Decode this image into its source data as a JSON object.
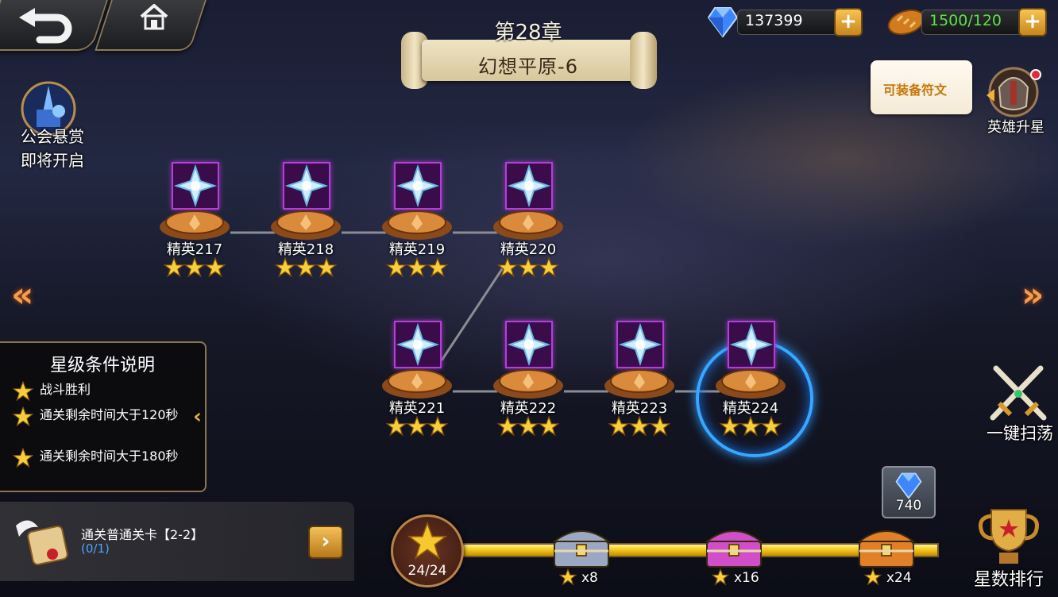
{
  "header": {
    "chapter": "第28章",
    "stage_name": "幻想平原-6"
  },
  "resources": {
    "diamonds": "137399",
    "stamina": "1500/120"
  },
  "left_panel": {
    "guild_bounty_line1": "公会悬赏",
    "guild_bounty_line2": "即将开启"
  },
  "tooltip": {
    "text": "可装备符文"
  },
  "right_panel": {
    "hero_star_up": "英雄升星",
    "one_click_sweep": "一键扫荡",
    "star_ranking": "星数排行"
  },
  "stages": [
    {
      "label": "精英217",
      "stars": 3
    },
    {
      "label": "精英218",
      "stars": 3
    },
    {
      "label": "精英219",
      "stars": 3
    },
    {
      "label": "精英220",
      "stars": 3
    },
    {
      "label": "精英221",
      "stars": 3
    },
    {
      "label": "精英222",
      "stars": 3
    },
    {
      "label": "精英223",
      "stars": 3
    },
    {
      "label": "精英224",
      "stars": 3,
      "selected": true
    }
  ],
  "star_conditions": {
    "title": "星级条件说明",
    "items": [
      "战斗胜利",
      "通关剩余时间大于120秒",
      "通关剩余时间大于180秒"
    ]
  },
  "quest": {
    "text": "通关普通关卡【2-2】",
    "progress": "(0/1)"
  },
  "star_progress": {
    "count": "24/24",
    "fraction": 1.0,
    "chests": [
      {
        "label": "x8",
        "color": "#9aa8c4"
      },
      {
        "label": "x16",
        "color": "#d04fc8"
      },
      {
        "label": "x24",
        "color": "#e2802a"
      }
    ],
    "reward_amount": "740"
  },
  "colors": {
    "accent_gold": "#f0c318",
    "stamina_green": "#5ee04a",
    "selection_blue": "#37a8ff"
  }
}
